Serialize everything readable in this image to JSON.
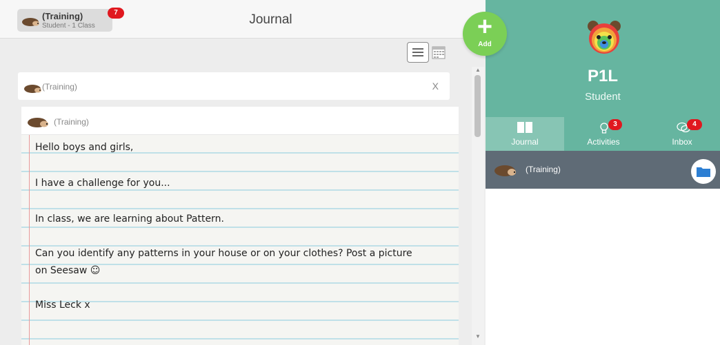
{
  "topbar": {
    "class_title": "(Training)",
    "class_subtitle": "Student - 1 Class",
    "notification_count": "7",
    "page_title": "Journal"
  },
  "filter": {
    "label": "(Training)",
    "close": "X"
  },
  "post": {
    "author": "(Training)",
    "lines": [
      "Hello boys and girls,",
      "I have a challenge for you...",
      "In class, we are learning about Pattern.",
      "Can you identify any patterns in your house or on your clothes? Post a picture",
      "on Seesaw ☺",
      "Miss Leck x"
    ]
  },
  "add_button": {
    "label": "Add"
  },
  "profile": {
    "name": "P1L",
    "role": "Student"
  },
  "tabs": [
    {
      "label": "Journal",
      "badge": ""
    },
    {
      "label": "Activities",
      "badge": "3"
    },
    {
      "label": "Inbox",
      "badge": "4"
    }
  ],
  "class_row": {
    "label": "(Training)"
  },
  "colors": {
    "accent_green": "#66b5a0",
    "add_green": "#7bcf56",
    "badge_red": "#e0181f",
    "class_row": "#5f6b76"
  }
}
